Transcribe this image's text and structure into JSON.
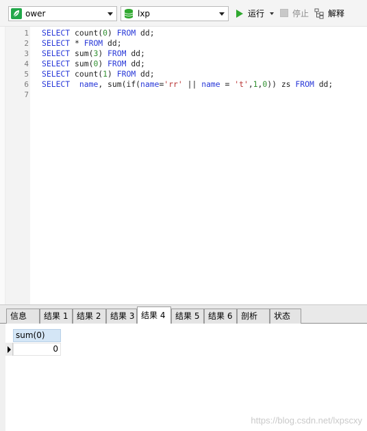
{
  "toolbar": {
    "connection": {
      "value": "ower",
      "icon": "connection-leaf-icon"
    },
    "database": {
      "value": "lxp",
      "icon": "database-icon"
    },
    "run_label": "运行",
    "stop_label": "停止",
    "explain_label": "解释",
    "accent_run": "#2fa82f",
    "accent_conn": "#22a84a"
  },
  "editor": {
    "line_numbers": [
      "1",
      "2",
      "3",
      "4",
      "5",
      "6",
      "7"
    ],
    "lines": [
      [
        {
          "t": "SELECT",
          "c": "kw"
        },
        {
          "t": " count(",
          "c": "idn"
        },
        {
          "t": "0",
          "c": "num"
        },
        {
          "t": ") ",
          "c": "idn"
        },
        {
          "t": "FROM",
          "c": "kw"
        },
        {
          "t": " dd;",
          "c": "idn"
        }
      ],
      [
        {
          "t": "SELECT",
          "c": "kw"
        },
        {
          "t": " * ",
          "c": "idn"
        },
        {
          "t": "FROM",
          "c": "kw"
        },
        {
          "t": " dd;",
          "c": "idn"
        }
      ],
      [
        {
          "t": "SELECT",
          "c": "kw"
        },
        {
          "t": " sum(",
          "c": "idn"
        },
        {
          "t": "3",
          "c": "num"
        },
        {
          "t": ") ",
          "c": "idn"
        },
        {
          "t": "FROM",
          "c": "kw"
        },
        {
          "t": " dd;",
          "c": "idn"
        }
      ],
      [
        {
          "t": "SELECT",
          "c": "kw"
        },
        {
          "t": " sum(",
          "c": "idn"
        },
        {
          "t": "0",
          "c": "num"
        },
        {
          "t": ") ",
          "c": "idn"
        },
        {
          "t": "FROM",
          "c": "kw"
        },
        {
          "t": " dd;",
          "c": "idn"
        }
      ],
      [
        {
          "t": "SELECT",
          "c": "kw"
        },
        {
          "t": " count(",
          "c": "idn"
        },
        {
          "t": "1",
          "c": "num"
        },
        {
          "t": ") ",
          "c": "idn"
        },
        {
          "t": "FROM",
          "c": "kw"
        },
        {
          "t": " dd;",
          "c": "idn"
        }
      ],
      [
        {
          "t": "SELECT",
          "c": "kw"
        },
        {
          "t": "  ",
          "c": "idn"
        },
        {
          "t": "name",
          "c": "kw"
        },
        {
          "t": ", sum(if(",
          "c": "idn"
        },
        {
          "t": "name",
          "c": "kw"
        },
        {
          "t": "=",
          "c": "idn"
        },
        {
          "t": "'rr'",
          "c": "str"
        },
        {
          "t": " || ",
          "c": "idn"
        },
        {
          "t": "name",
          "c": "kw"
        },
        {
          "t": " = ",
          "c": "idn"
        },
        {
          "t": "'t'",
          "c": "str"
        },
        {
          "t": ",",
          "c": "idn"
        },
        {
          "t": "1",
          "c": "num"
        },
        {
          "t": ",",
          "c": "idn"
        },
        {
          "t": "0",
          "c": "num"
        },
        {
          "t": ")) zs ",
          "c": "idn"
        },
        {
          "t": "FROM",
          "c": "kw"
        },
        {
          "t": " dd;",
          "c": "idn"
        }
      ],
      []
    ]
  },
  "result_tabs": [
    {
      "label": "信息",
      "active": false
    },
    {
      "label": "结果 1",
      "active": false
    },
    {
      "label": "结果 2",
      "active": false
    },
    {
      "label": "结果 3",
      "active": false
    },
    {
      "label": "结果 4",
      "active": true
    },
    {
      "label": "结果 5",
      "active": false
    },
    {
      "label": "结果 6",
      "active": false
    },
    {
      "label": "剖析",
      "active": false
    },
    {
      "label": "状态",
      "active": false
    }
  ],
  "grid": {
    "columns": [
      "sum(0)"
    ],
    "rows": [
      [
        "0"
      ]
    ]
  },
  "watermark": "https://blog.csdn.net/lxpscxy"
}
